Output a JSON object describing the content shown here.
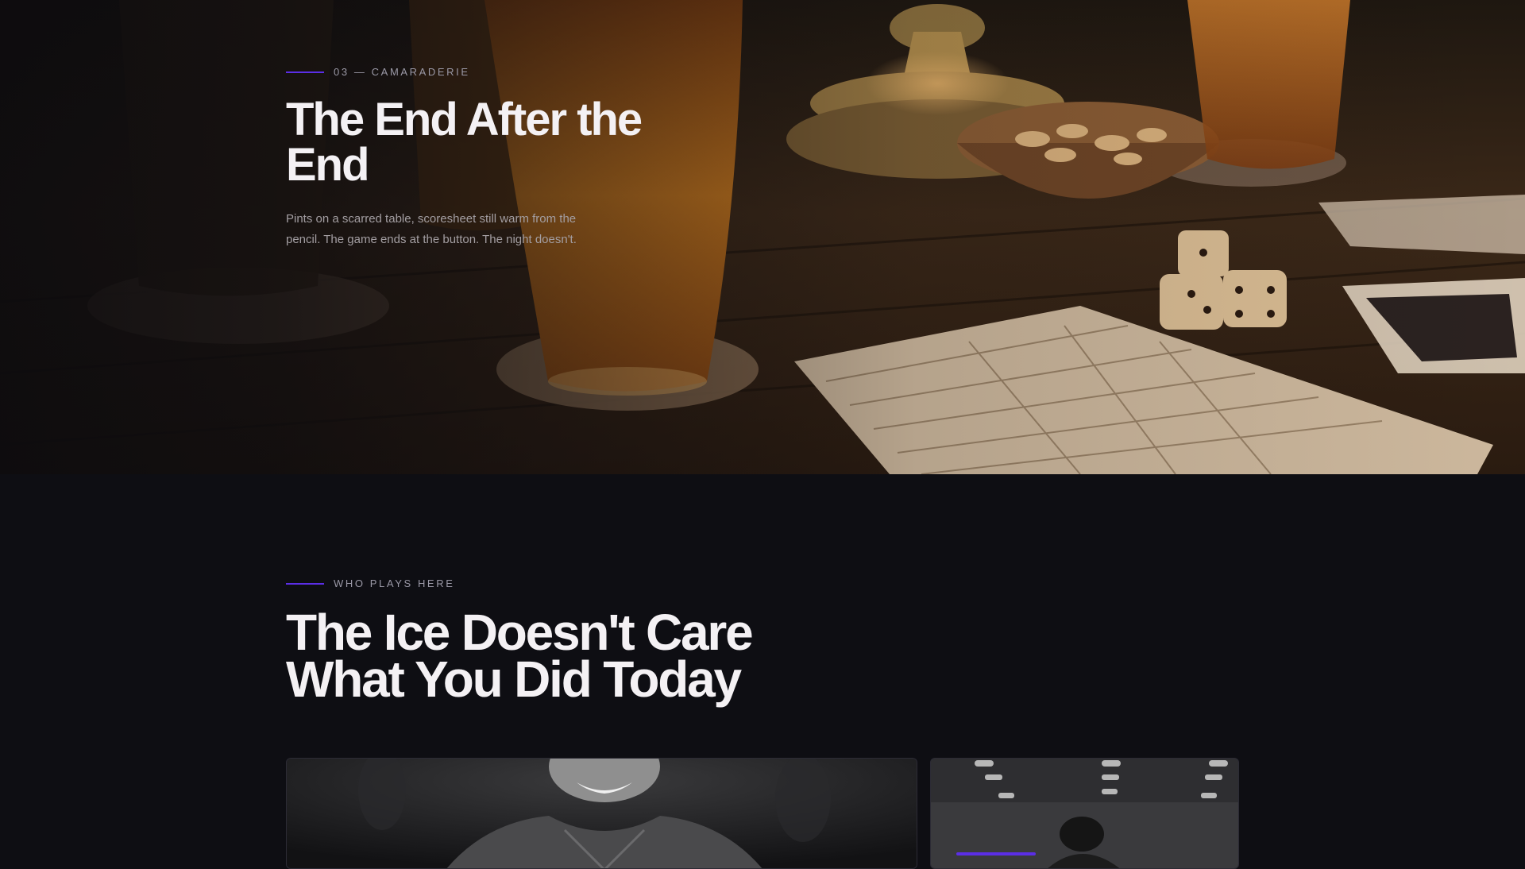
{
  "hero": {
    "eyebrow": "03 — CAMARADERIE",
    "title": "The End After the End",
    "description": "Pints on a scarred table, scoresheet still warm from the pencil. The game ends at the button. The night doesn't.",
    "image_subject": "pints, dice and a scoresheet on a wooden pub table"
  },
  "section": {
    "eyebrow": "WHO PLAYS HERE",
    "title": "The Ice Doesn't Care What You Did Today",
    "cards": [
      {
        "image_subject": "smiling hockey player in black and white"
      },
      {
        "image_subject": "hockey player on the ice in an arena"
      }
    ]
  },
  "colors": {
    "background": "#0e0e13",
    "accent": "#5b2ee6",
    "heading": "#f4f1f4",
    "muted_text": "#a39ea2"
  }
}
